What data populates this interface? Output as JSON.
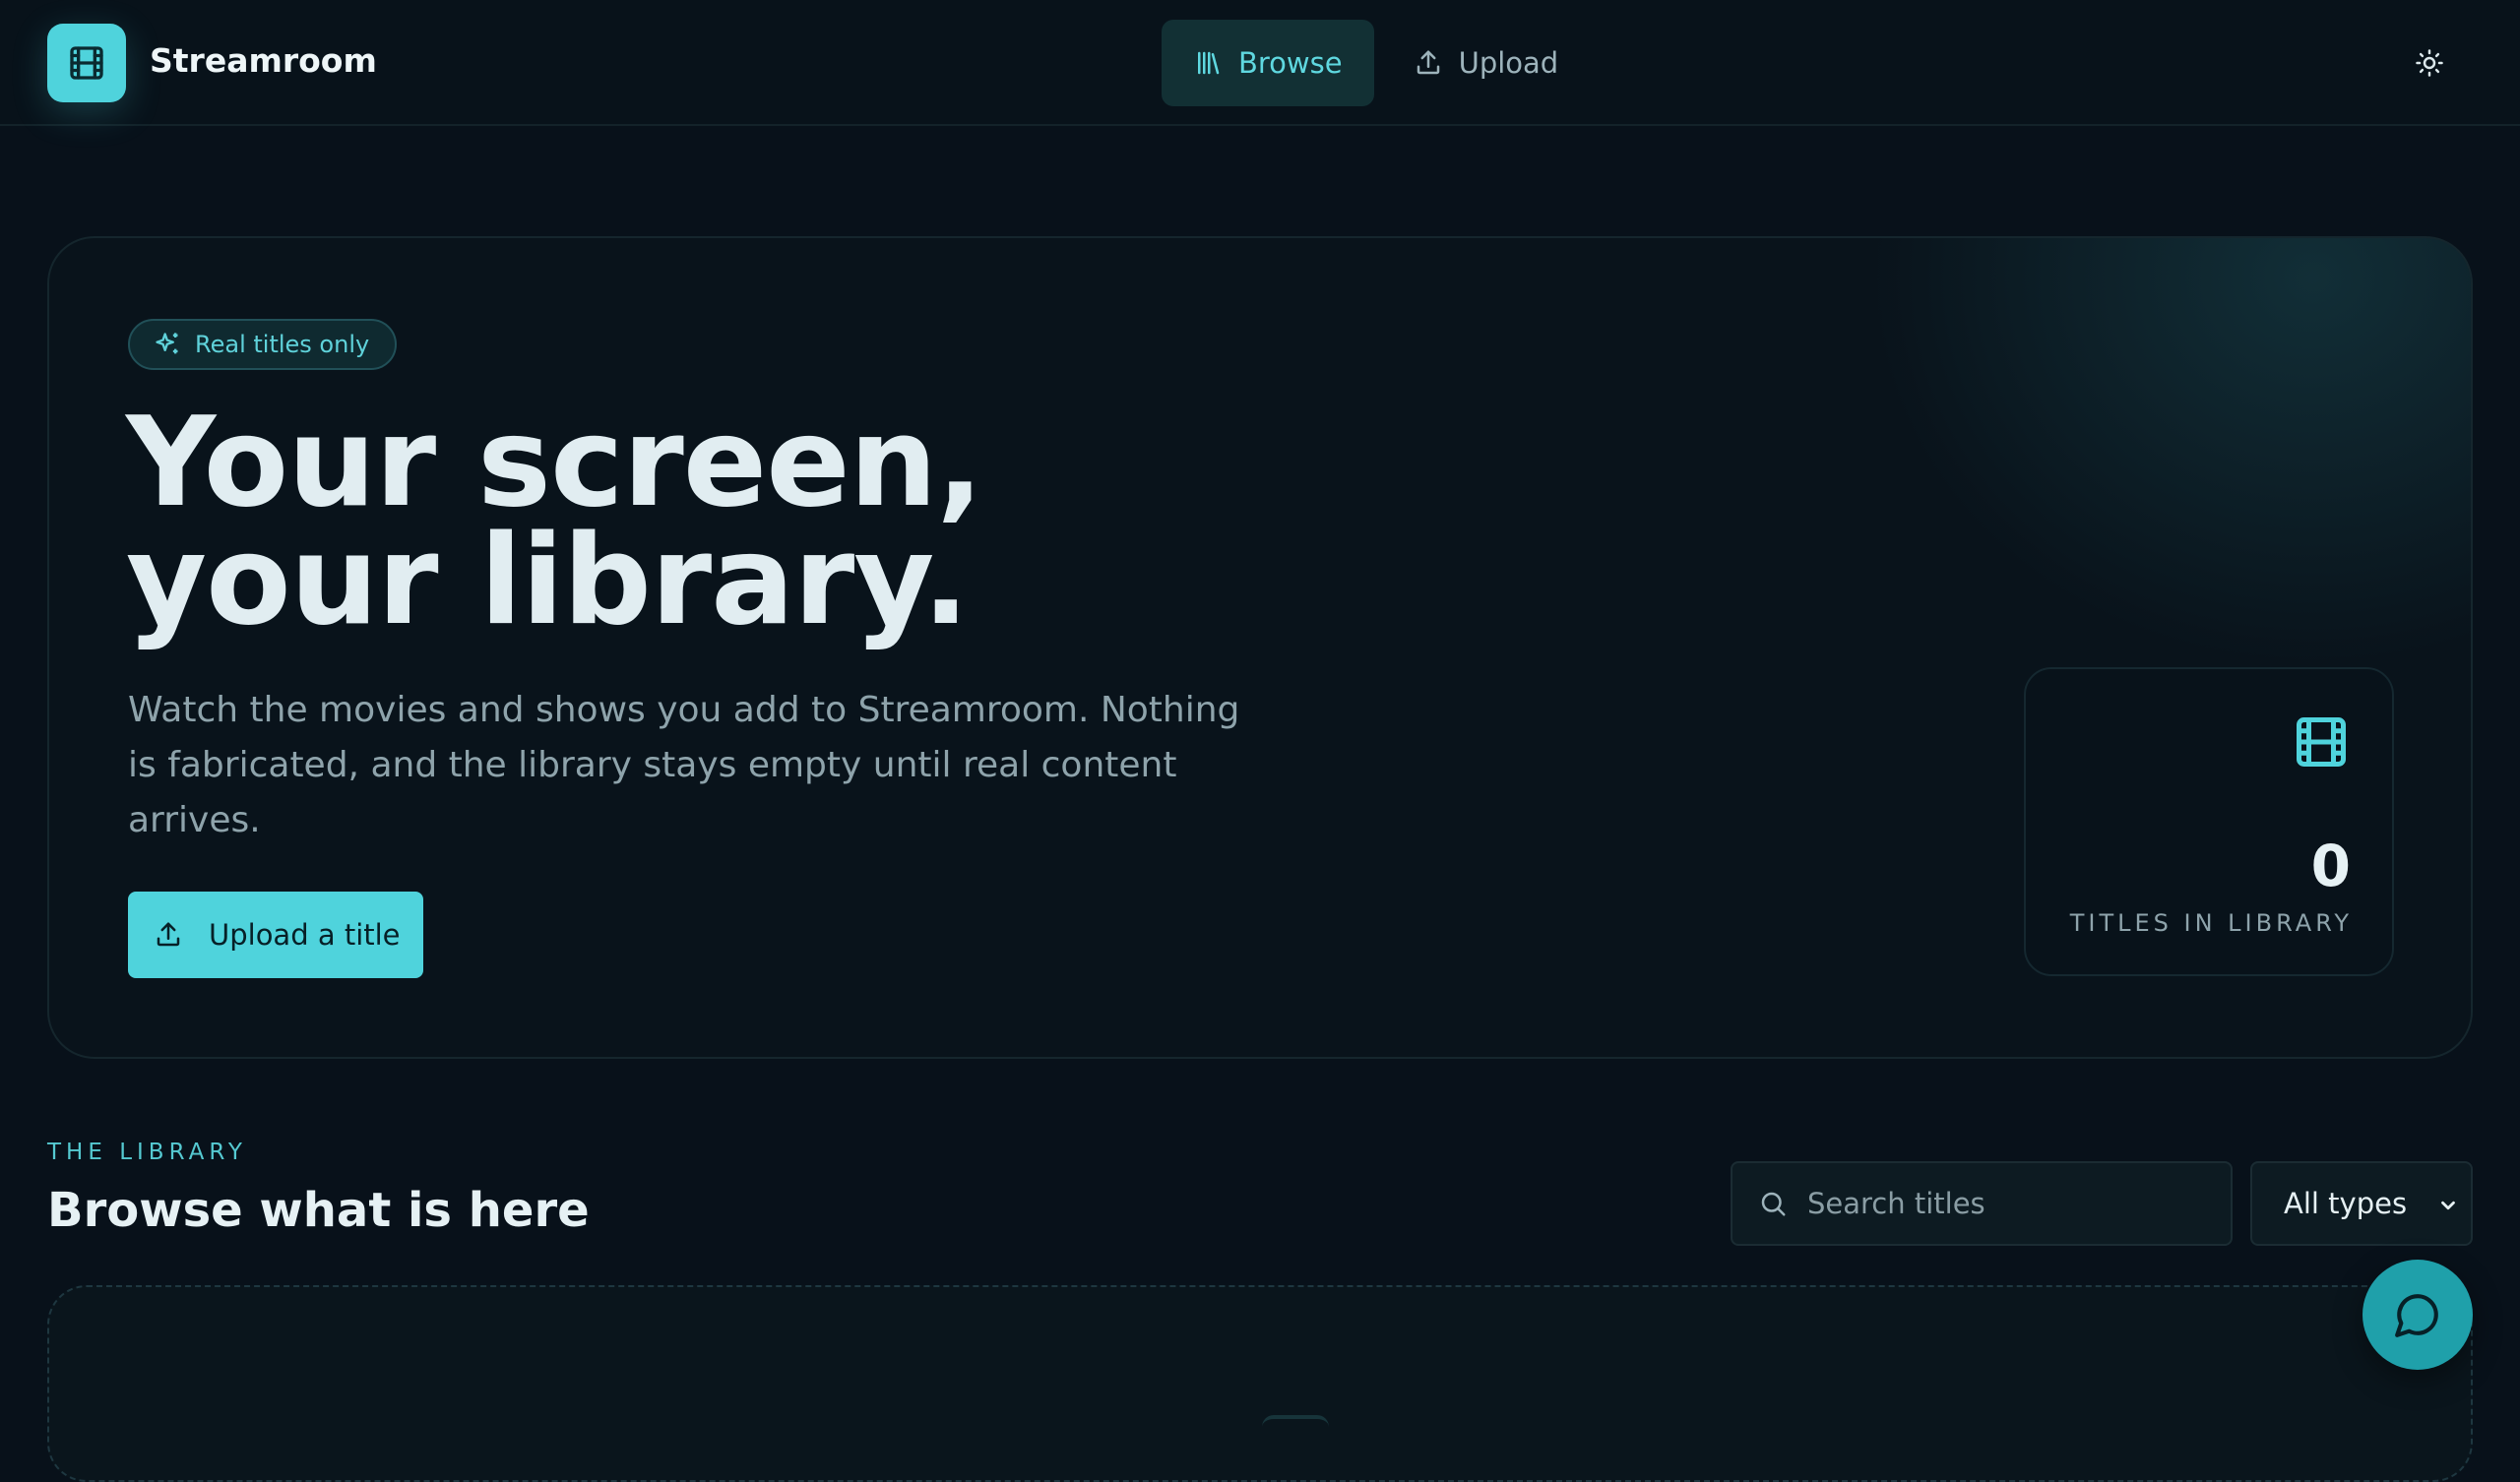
{
  "app": {
    "name": "Streamroom"
  },
  "nav": {
    "items": [
      {
        "label": "Browse",
        "icon": "library-icon",
        "active": true
      },
      {
        "label": "Upload",
        "icon": "upload-icon",
        "active": false
      }
    ],
    "theme_toggle_icon": "sun-icon"
  },
  "hero": {
    "badge": "Real titles only",
    "title_line1": "Your screen,",
    "title_line2": "your library.",
    "description": "Watch the movies and shows you add to Streamroom. Nothing is fabricated, and the library stays empty until real content arrives.",
    "cta_label": "Upload a title",
    "stat": {
      "value": "0",
      "label": "TITLES IN LIBRARY",
      "icon": "film-icon"
    }
  },
  "library": {
    "eyebrow": "THE LIBRARY",
    "title": "Browse what is here",
    "search_placeholder": "Search titles",
    "type_filter": "All types"
  },
  "colors": {
    "accent": "#4fd3dc",
    "background": "#08111a",
    "active_nav_bg": "#123034"
  }
}
